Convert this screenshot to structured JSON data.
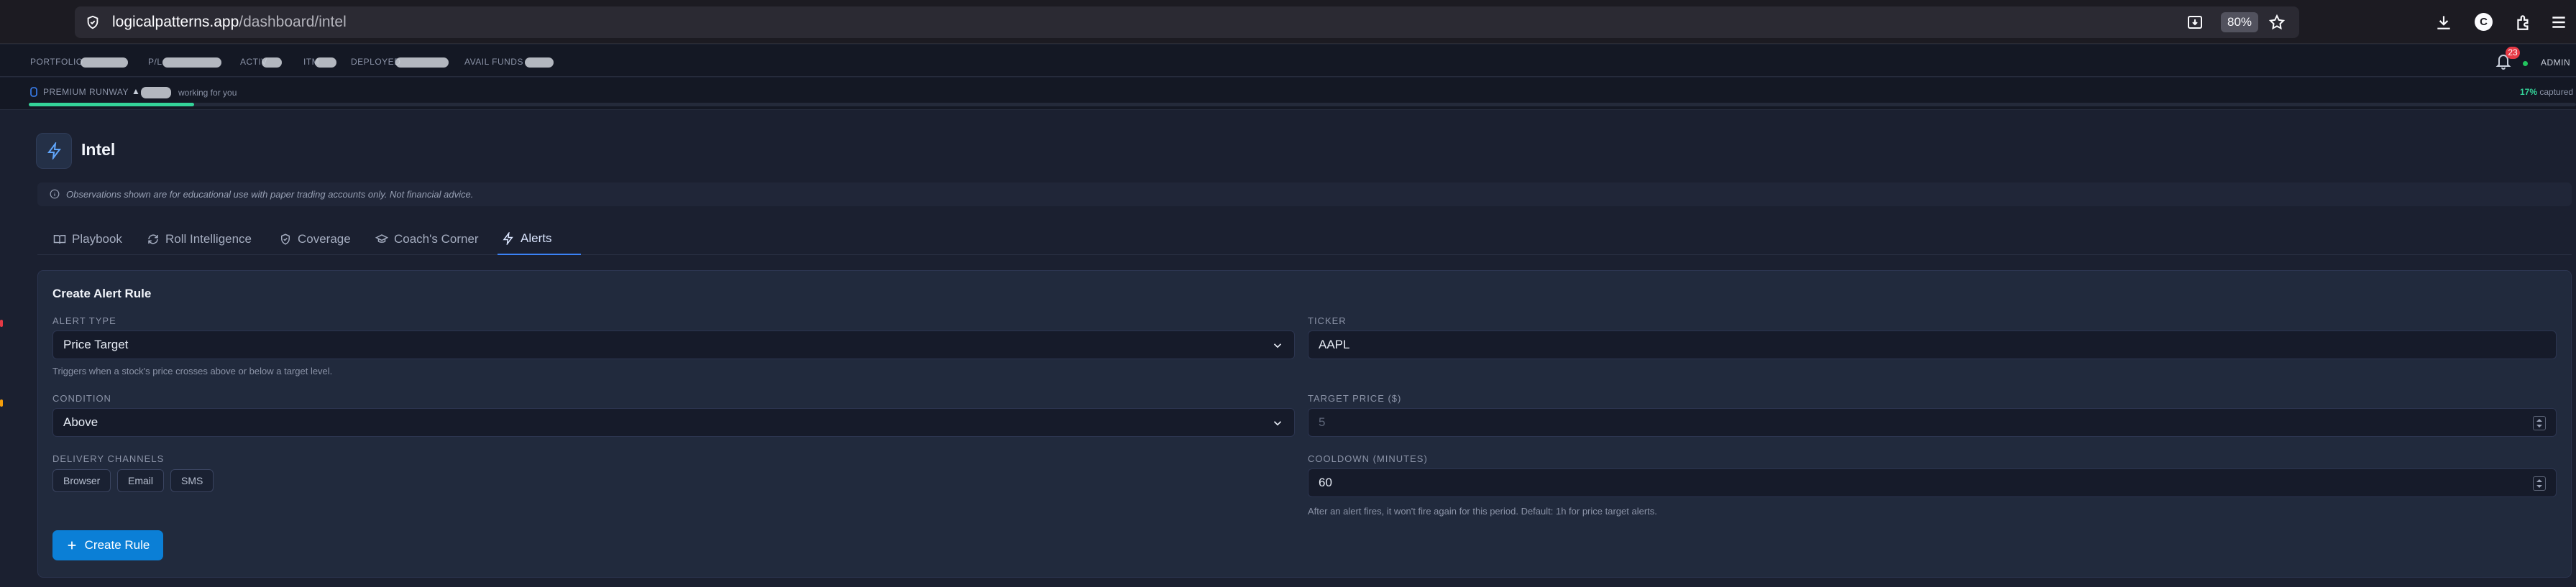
{
  "browser": {
    "url_host": "logicalpatterns.app",
    "url_path": "/dashboard/intel",
    "zoom": "80%",
    "profile_initial": "C"
  },
  "stats": {
    "portfolio_label": "PORTFOLIO",
    "pl_label": "P/L",
    "active_label": "ACTIV",
    "itm_label": "ITM",
    "deployed_label": "DEPLOYED",
    "avail_funds_label": "AVAIL FUNDS",
    "notification_count": "23",
    "admin_label": "ADMIN"
  },
  "runway": {
    "label": "PREMIUM RUNWAY",
    "arrow": "▲",
    "text": "working for you",
    "captured_pct": "17%",
    "captured_label": "captured",
    "progress_fraction": 0.065
  },
  "page": {
    "title": "Intel",
    "disclaimer": "Observations shown are for educational use with paper trading accounts only. Not financial advice."
  },
  "tabs": [
    {
      "label": "Playbook",
      "icon": "book-icon"
    },
    {
      "label": "Roll Intelligence",
      "icon": "refresh-icon"
    },
    {
      "label": "Coverage",
      "icon": "shield-check-icon"
    },
    {
      "label": "Coach's Corner",
      "icon": "graduation-cap-icon"
    },
    {
      "label": "Alerts",
      "icon": "zap-icon",
      "active": true
    }
  ],
  "form": {
    "title": "Create Alert Rule",
    "alert_type_label": "ALERT TYPE",
    "alert_type_value": "Price Target",
    "alert_type_hint": "Triggers when a stock's price crosses above or below a target level.",
    "ticker_label": "TICKER",
    "ticker_value": "AAPL",
    "condition_label": "CONDITION",
    "condition_value": "Above",
    "target_price_label": "TARGET PRICE ($)",
    "target_price_placeholder": "5",
    "delivery_label": "DELIVERY CHANNELS",
    "channels": [
      "Browser",
      "Email",
      "SMS"
    ],
    "cooldown_label": "COOLDOWN (MINUTES)",
    "cooldown_value": "60",
    "cooldown_hint": "After an alert fires, it won't fire again for this period. Default: 1h for price target alerts.",
    "create_label": "Create Rule"
  },
  "colors": {
    "accent": "#3b82f6",
    "button": "#0b7fd6",
    "progress": "#34d399",
    "badge": "#e53945"
  }
}
